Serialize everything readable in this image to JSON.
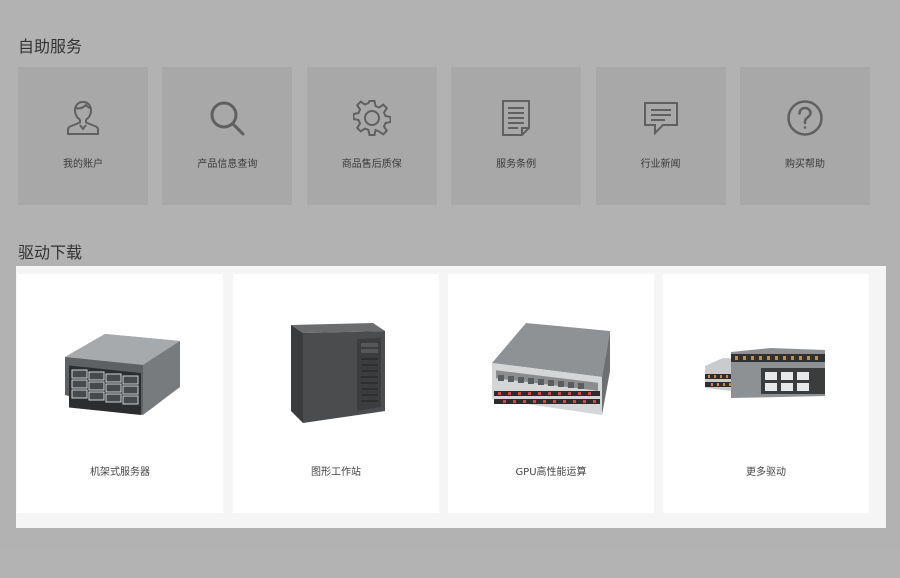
{
  "sections": {
    "self_service": "自助服务",
    "drivers": "驱动下载"
  },
  "services": [
    {
      "label": "我的账户",
      "icon": "user-icon"
    },
    {
      "label": "产品信息查询",
      "icon": "search-icon"
    },
    {
      "label": "商品售后质保",
      "icon": "gear-icon"
    },
    {
      "label": "服务条例",
      "icon": "document-icon"
    },
    {
      "label": "行业新闻",
      "icon": "message-icon"
    },
    {
      "label": "购买帮助",
      "icon": "help-icon"
    }
  ],
  "drivers": [
    {
      "label": "机架式服务器",
      "image": "rack-server-image"
    },
    {
      "label": "图形工作站",
      "image": "tower-workstation-image"
    },
    {
      "label": "GPU高性能运算",
      "image": "gpu-server-image"
    },
    {
      "label": "更多驱动",
      "image": "more-servers-image"
    }
  ],
  "colors": {
    "overlay": "#b2b2b2",
    "service_card": "#a8a8a8",
    "icon_stroke": "#606060",
    "driver_card": "#ffffff",
    "driver_panel": "#f5f5f5"
  }
}
